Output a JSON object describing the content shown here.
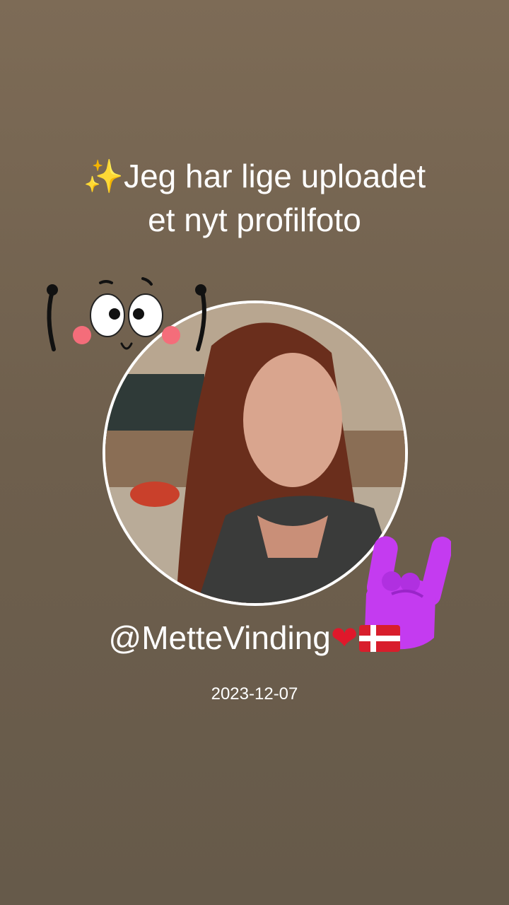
{
  "headline": {
    "sparkle": "✨",
    "line1": "Jeg har lige uploadet",
    "line2": "et nyt profilfoto"
  },
  "profile": {
    "handle": "@MetteVinding",
    "heart": "❤"
  },
  "date": "2023-12-07",
  "stickers": {
    "face": "cute-face-sticker",
    "rock": "rock-on-hand-sticker",
    "flag": "denmark-flag-icon"
  },
  "colors": {
    "background_top": "#7d6b56",
    "background_bottom": "#665a4a",
    "text": "#ffffff",
    "heart": "#e0182b",
    "rock_hand": "#c43bf0",
    "flag_red": "#d81e2c"
  }
}
